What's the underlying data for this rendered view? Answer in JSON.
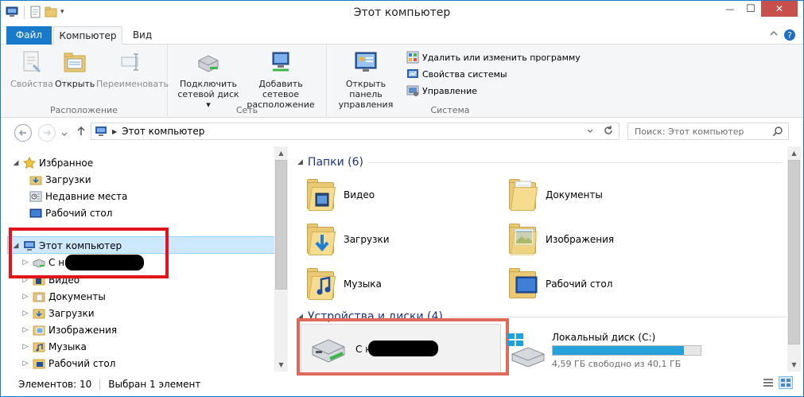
{
  "window": {
    "title": "Этот компьютер"
  },
  "title_controls": {
    "minimize": "—",
    "maximize": "☐",
    "close": "✕"
  },
  "ribbon": {
    "tabs": {
      "file": "Файл",
      "computer": "Компьютер",
      "view": "Вид"
    },
    "groups": {
      "location": {
        "label": "Расположение",
        "properties": "Свойства",
        "open": "Открыть",
        "rename": "Переименовать"
      },
      "network": {
        "label": "Сеть",
        "map_drive": [
          "Подключить",
          "сетевой диск ▾"
        ],
        "add_location": [
          "Добавить сетевое",
          "расположение"
        ]
      },
      "system": {
        "label": "Система",
        "control_panel": [
          "Открыть панель",
          "управления"
        ],
        "uninstall": "Удалить или изменить программу",
        "sys_props": "Свойства системы",
        "manage": "Управление"
      }
    }
  },
  "address": {
    "path": "Этот компьютер",
    "search_placeholder": "Поиск: Этот компьютер"
  },
  "navpane": {
    "favorites": "Избранное",
    "fav_items": [
      "Загрузки",
      "Недавние места",
      "Рабочий стол"
    ],
    "this_pc": "Этот компьютер",
    "pc_items": [
      "С на",
      "Видео",
      "Документы",
      "Загрузки",
      "Изображения",
      "Музыка",
      "Рабочий стол"
    ]
  },
  "content": {
    "folders_header": "Папки (6)",
    "folders": [
      "Видео",
      "Документы",
      "Загрузки",
      "Изображения",
      "Музыка",
      "Рабочий стол"
    ],
    "devices_header": "Устройства и диски (4)",
    "net_drive": "С на",
    "local_disk": {
      "name": "Локальный диск (C:)",
      "free_text": "4,59 ГБ свободно из 40,1 ГБ",
      "used_fraction": 0.886,
      "bar_color": "#26a0da"
    }
  },
  "status": {
    "count": "Элементов: 10",
    "selected": "Выбран 1 элемент"
  }
}
